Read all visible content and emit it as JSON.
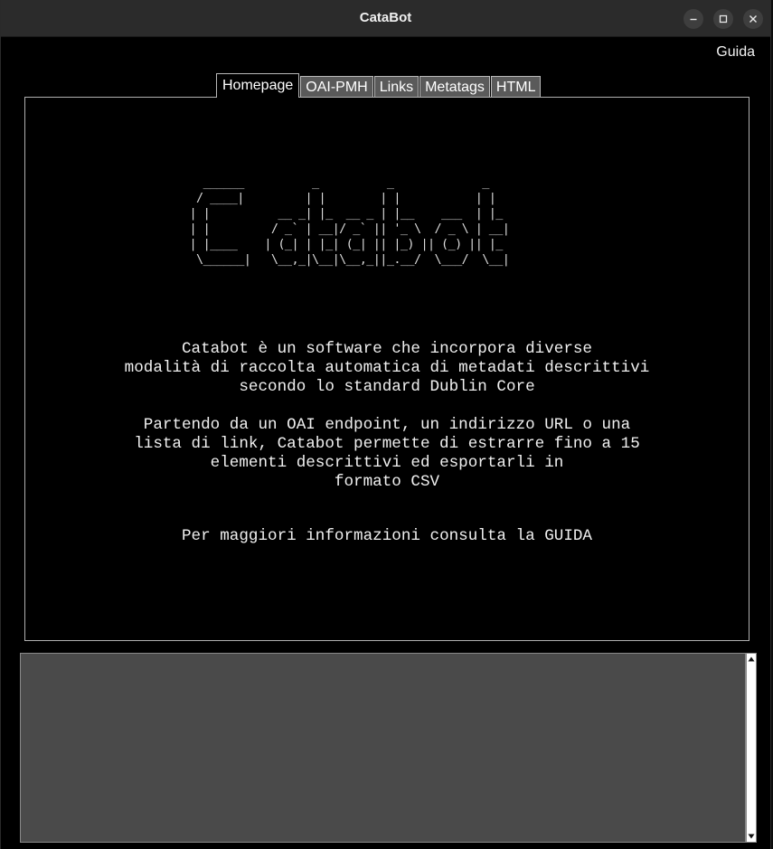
{
  "window": {
    "title": "CataBot",
    "controls": [
      "minimize-icon",
      "maximize-icon",
      "close-icon"
    ]
  },
  "menu": {
    "guida": "Guida"
  },
  "tabs": [
    {
      "label": "Homepage",
      "active": true
    },
    {
      "label": "OAI-PMH",
      "active": false
    },
    {
      "label": "Links",
      "active": false
    },
    {
      "label": "Metatags",
      "active": false
    },
    {
      "label": "HTML",
      "active": false
    }
  ],
  "homepage": {
    "ascii_logo": "   ______          _          _             _   \n  / ____|         | |        | |           | |  \n | |          __ _| |_  __ _ | |__    ___  | |_ \n | |         / _` | __|/ _` || '_ \\  / _ \\ | __|\n | |____    | (_| | |_| (_| || |_) || (_) || |_ \n  \\______|   \\__,_|\\__|\\__,_||_.__/  \\___/  \\__|",
    "description_1": "Catabot è un software che incorpora diverse\nmodalità di raccolta automatica di metadati descrittivi\nsecondo lo standard Dublin Core",
    "description_2": "Partendo da un OAI endpoint, un indirizzo URL o una\nlista di link, Catabot permette di estrarre fino a 15\nelementi descrittivi ed esportarli in\nformato CSV",
    "guide_hint": "Per maggiori informazioni consulta la GUIDA"
  },
  "log": {
    "content": ""
  },
  "colors": {
    "background": "#000000",
    "titlebar": "#2b2b2b",
    "inactive_tab": "#5a5a5a",
    "log_area": "#4a4a4a",
    "text": "#f0f0f0"
  }
}
